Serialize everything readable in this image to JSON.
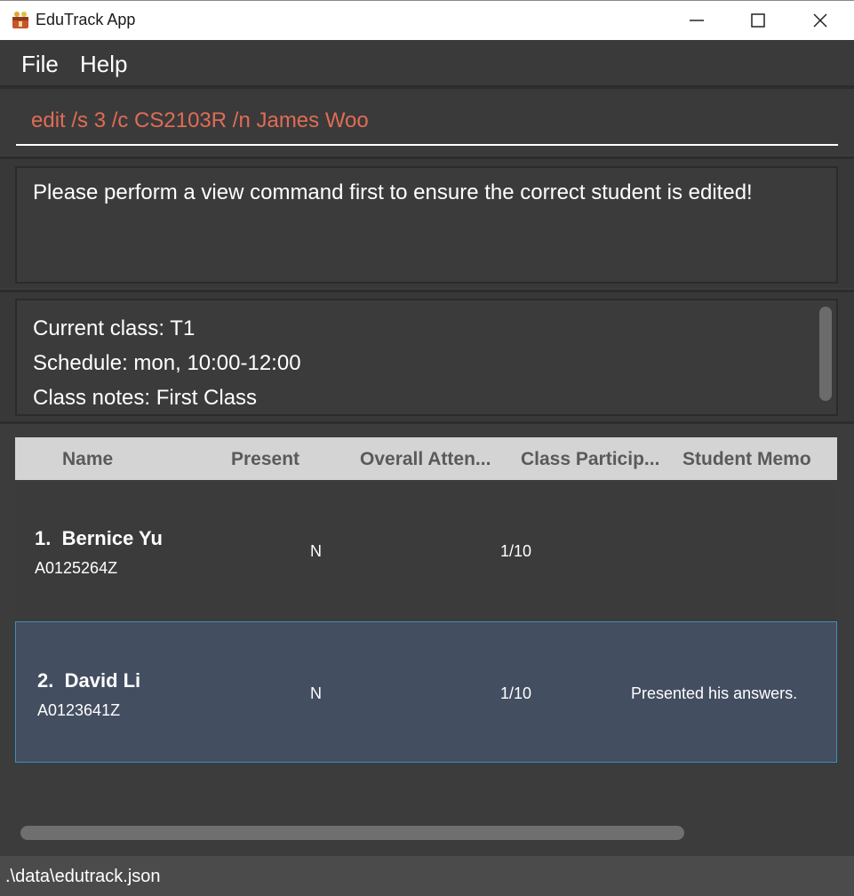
{
  "window": {
    "title": "EduTrack App",
    "icon": "app-icon"
  },
  "menu": {
    "file": "File",
    "help": "Help"
  },
  "command": {
    "text": "edit /s 3 /c CS2103R /n James Woo",
    "color": "#e06c55"
  },
  "result": {
    "message": "Please perform a view command first to ensure the correct student is edited!"
  },
  "class_info": {
    "current_class": "Current class: T1",
    "schedule": "Schedule: mon, 10:00-12:00",
    "notes": "Class notes: First Class"
  },
  "table": {
    "headers": [
      "Name",
      "Present",
      "Overall Atten...",
      "Class Particip...",
      "Student Memo"
    ],
    "rows": [
      {
        "index": "1.",
        "name": "Bernice Yu",
        "id": "A0125264Z",
        "present": "N",
        "participation": "1/10",
        "memo": ""
      },
      {
        "index": "2.",
        "name": "David Li",
        "id": "A0123641Z",
        "present": "N",
        "participation": "1/10",
        "memo": "Presented his answers."
      }
    ],
    "selected_row_color": "#434e61"
  },
  "status": {
    "path": ".\\data\\edutrack.json"
  }
}
